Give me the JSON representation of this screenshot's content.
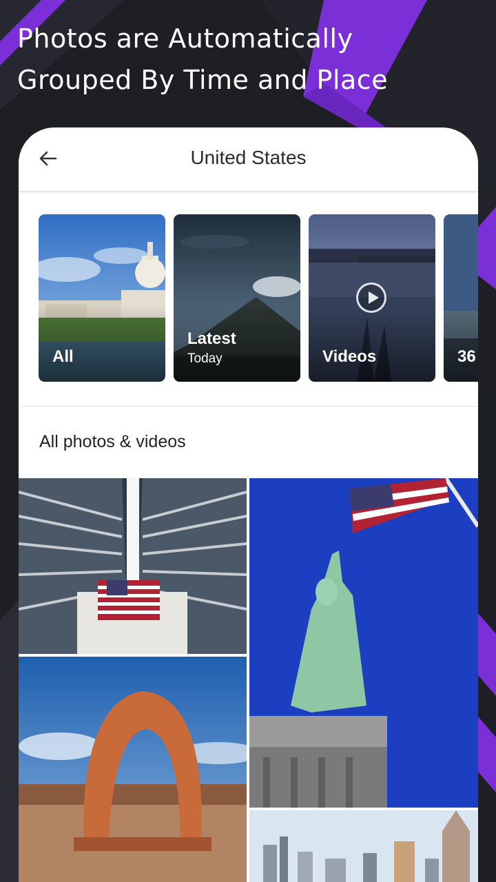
{
  "promo": {
    "headline_line1": "Photos are Automatically",
    "headline_line2": "Grouped By Time and Place"
  },
  "header": {
    "back_icon": "arrow-left-icon",
    "title": "United States"
  },
  "albums": [
    {
      "label": "All",
      "sublabel": ""
    },
    {
      "label": "Latest",
      "sublabel": "Today"
    },
    {
      "label": "Videos",
      "sublabel": "",
      "icon": "play-icon"
    },
    {
      "label": "36",
      "sublabel": ""
    }
  ],
  "section": {
    "title": "All photos & videos"
  },
  "colors": {
    "background": "#1e1f25",
    "accent": "#7b2fd6",
    "card": "#ffffff"
  }
}
